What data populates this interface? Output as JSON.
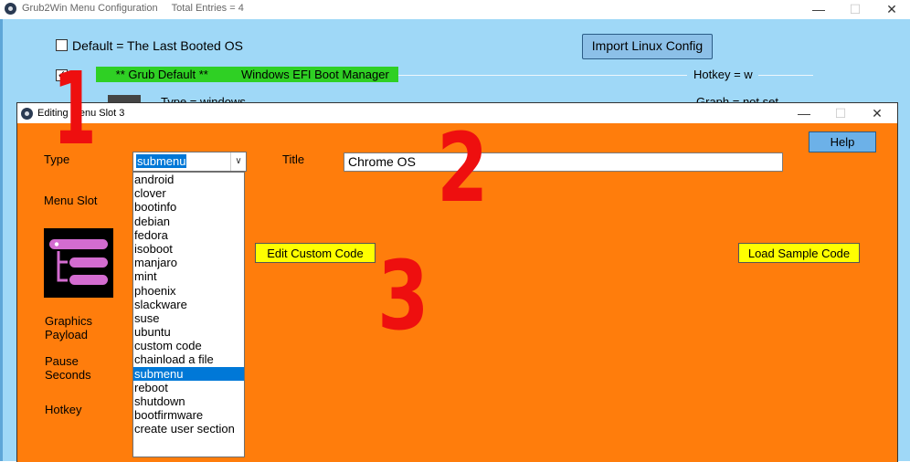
{
  "back_window": {
    "title": "Grub2Win Menu Configuration     Total Entries = 4",
    "controls": {
      "minimize": "—",
      "maximize": "☐",
      "close": "✕"
    },
    "default_checkbox_label": "Default = The Last Booted OS",
    "import_button": "Import Linux Config",
    "entry": {
      "label": "      ** Grub Default **          Windows EFI Boot Manager",
      "hotkey": "Hotkey = w",
      "type_text": "Type = windows",
      "graph_text": "Graph = not set",
      "checked_mark": "✓"
    }
  },
  "annotations": [
    "1",
    "2",
    "3"
  ],
  "dialog": {
    "title": "Editing Menu Slot 3",
    "controls": {
      "minimize": "—",
      "maximize": "☐",
      "close": "✕"
    },
    "labels": {
      "type": "Type",
      "title": "Title",
      "menu_slot": "Menu Slot",
      "graphics": "Graphics",
      "payload": "Payload",
      "pause": "Pause",
      "seconds": "Seconds",
      "hotkey": "Hotkey"
    },
    "type_value": "submenu",
    "title_value": "Chrome OS",
    "help_button": "Help",
    "edit_custom_code_button": "Edit Custom Code",
    "load_sample_code_button": "Load Sample Code",
    "type_options": [
      "android",
      "clover",
      "bootinfo",
      "debian",
      "fedora",
      "isoboot",
      "manjaro",
      "mint",
      "phoenix",
      "slackware",
      "suse",
      "ubuntu",
      "custom code",
      "chainload a file",
      "submenu",
      "reboot",
      "shutdown",
      "bootfirmware",
      "create user section"
    ],
    "selected_option": "submenu"
  },
  "colors": {
    "back_bg": "#9fd8f7",
    "dialog_bg": "#ff7d0c",
    "entry_green": "#2fd024",
    "annotation_red": "#ee0f0f",
    "selection_blue": "#0078d7",
    "button_yellow": "#ffff00"
  }
}
